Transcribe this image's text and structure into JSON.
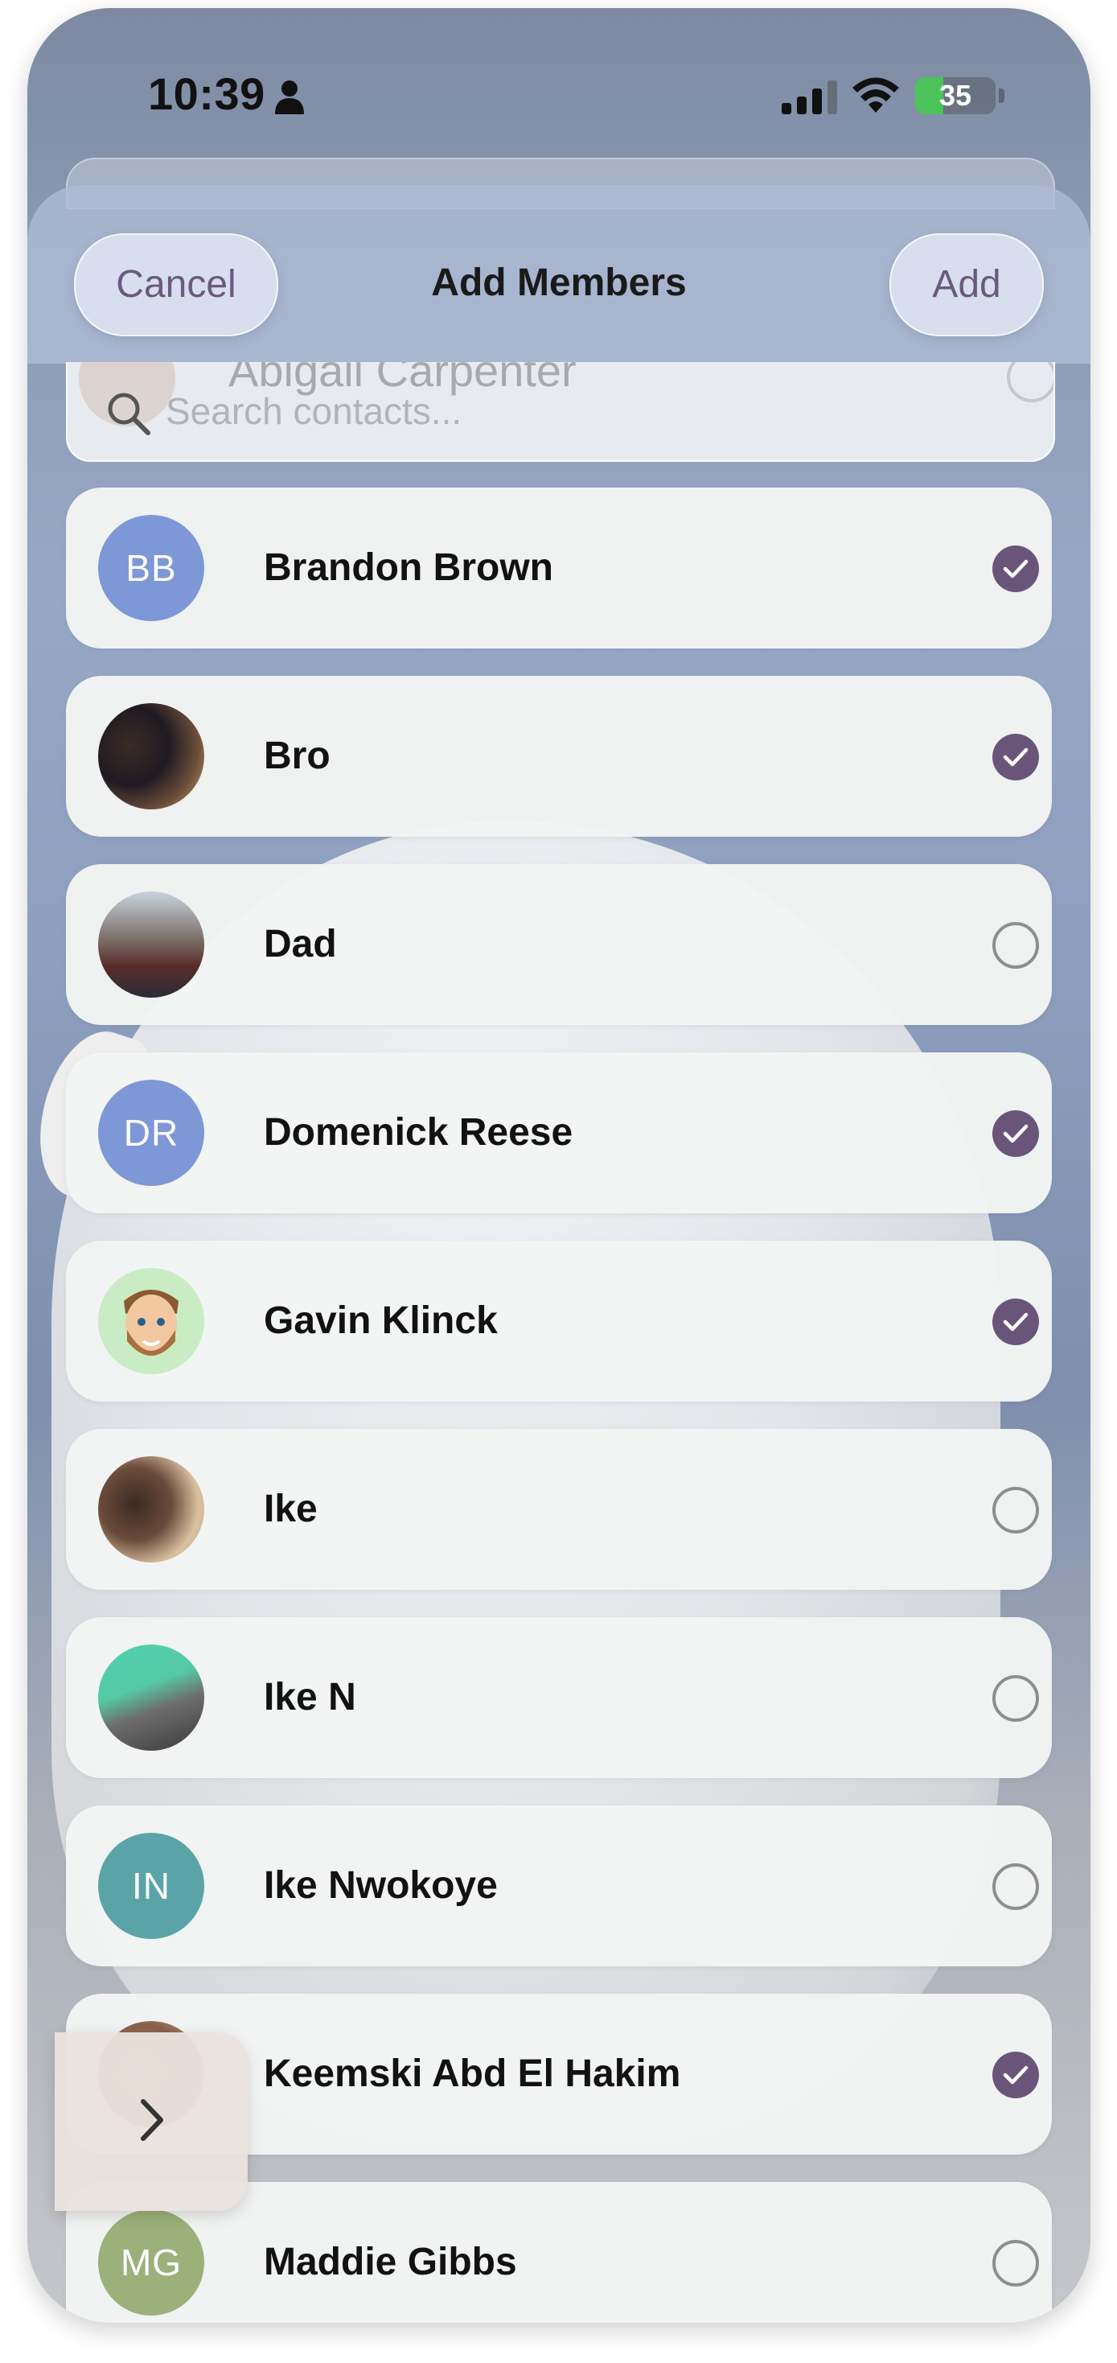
{
  "status_bar": {
    "time": "10:39",
    "battery": "35",
    "battery_level": 0.35
  },
  "header": {
    "cancel_label": "Cancel",
    "title": "Add Members",
    "add_label": "Add"
  },
  "search": {
    "placeholder": "Search contacts...",
    "value": "",
    "partial_row_name": "Abigail Carpenter"
  },
  "colors": {
    "accent": "#6a557a",
    "checked": "#6a557a"
  },
  "contacts": [
    {
      "name": "Brandon Brown",
      "initials": "BB",
      "avatar_type": "initials",
      "avatar_color": "#7e97d6",
      "selected": true
    },
    {
      "name": "Bro",
      "initials": "",
      "avatar_type": "photo",
      "selected": true
    },
    {
      "name": "Dad",
      "initials": "",
      "avatar_type": "photo",
      "selected": false
    },
    {
      "name": "Domenick Reese",
      "initials": "DR",
      "avatar_type": "initials",
      "avatar_color": "#7e97d6",
      "selected": true
    },
    {
      "name": "Gavin Klinck",
      "initials": "",
      "avatar_type": "memoji",
      "selected": true
    },
    {
      "name": "Ike",
      "initials": "",
      "avatar_type": "photo",
      "selected": false
    },
    {
      "name": "Ike N",
      "initials": "",
      "avatar_type": "photo",
      "selected": false
    },
    {
      "name": "Ike Nwokoye",
      "initials": "IN",
      "avatar_type": "initials",
      "avatar_color": "#5aa4a8",
      "selected": false
    },
    {
      "name": "Keemski Abd El Hakim",
      "initials": "",
      "avatar_type": "photo",
      "selected": true
    },
    {
      "name": "Maddie Gibbs",
      "initials": "MG",
      "avatar_type": "initials",
      "avatar_color": "#9bb07a",
      "selected": false
    }
  ],
  "side_tab": {
    "icon": "chevron-right-icon"
  }
}
